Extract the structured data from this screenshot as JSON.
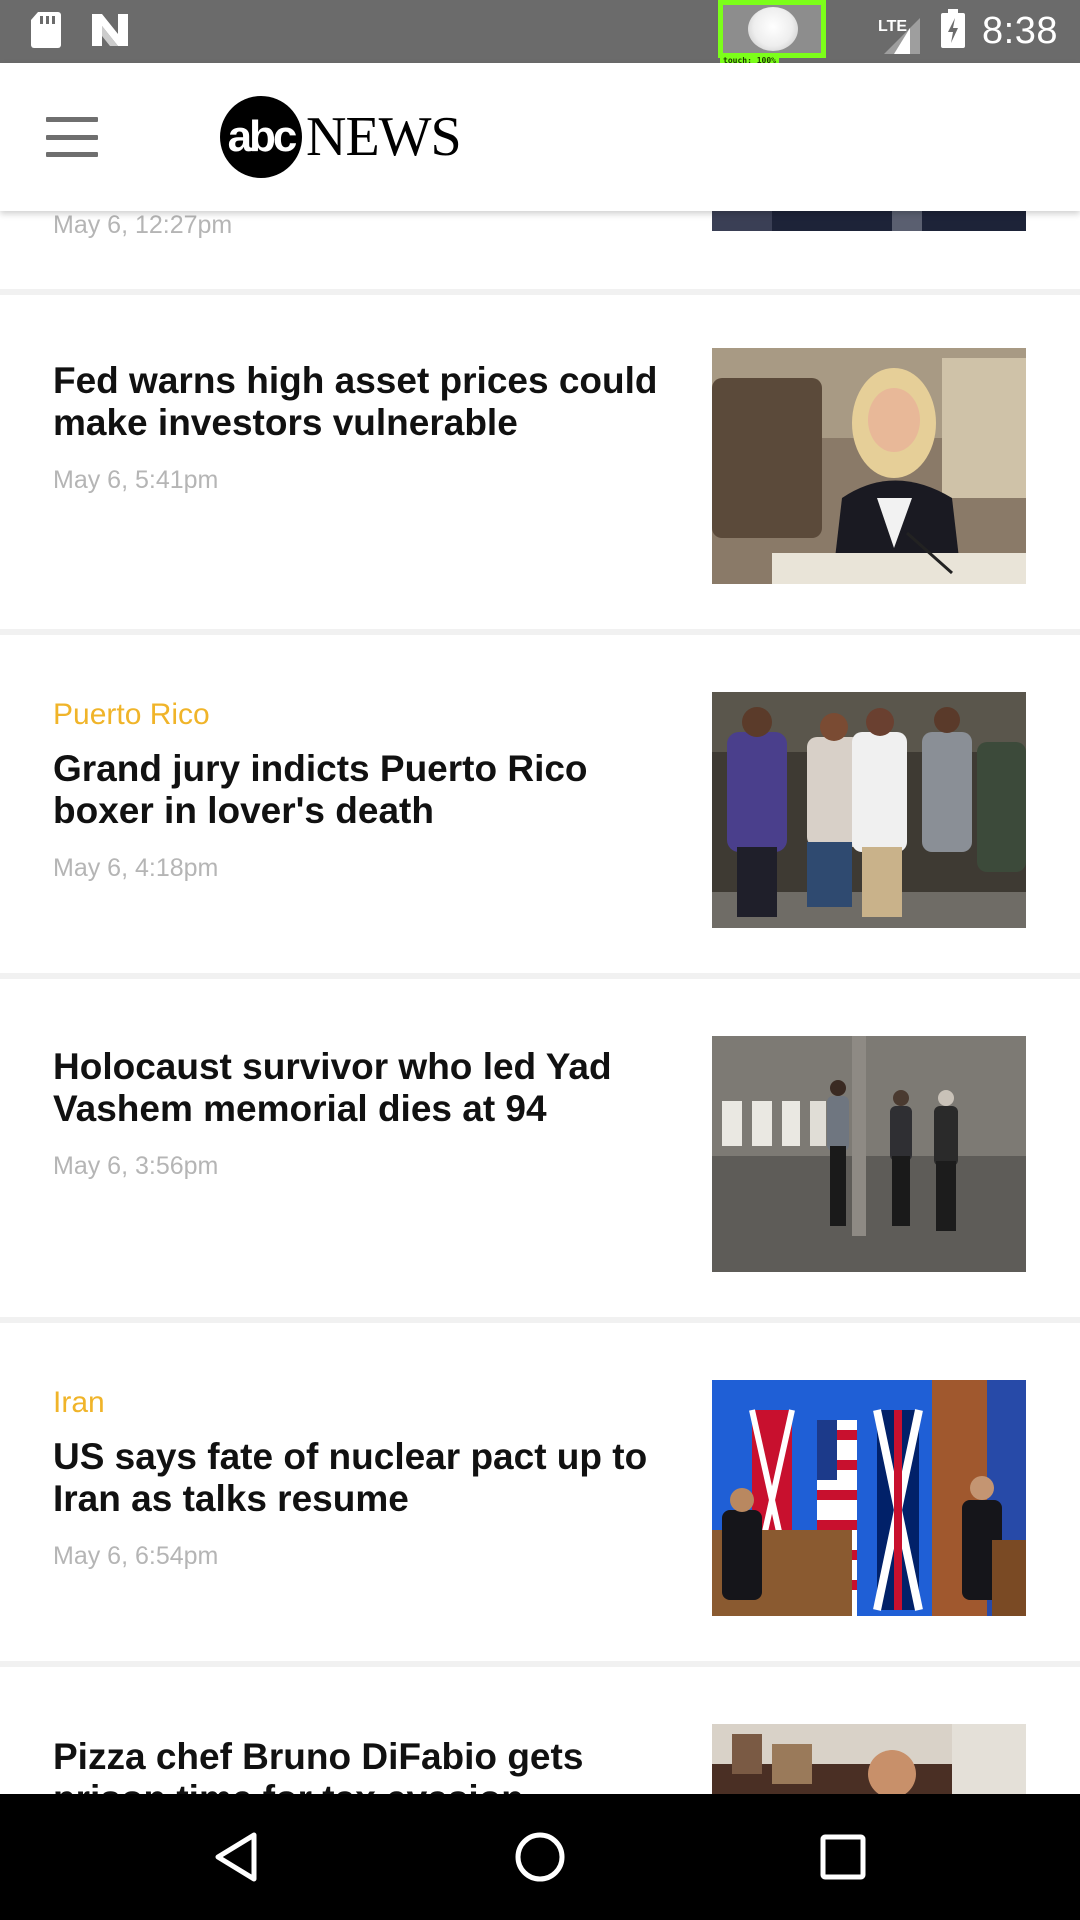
{
  "status_bar": {
    "clock": "8:38",
    "network": "LTE",
    "touch_label": "touch: 100%",
    "left_icons": [
      "sd-card-icon",
      "n-logo-icon"
    ],
    "right_icons": [
      "signal-icon",
      "battery-charging-icon"
    ]
  },
  "app_bar": {
    "logo_circle": "abc",
    "logo_word": "NEWS",
    "menu_icon": "hamburger-menu-icon"
  },
  "articles": [
    {
      "category": "",
      "headline": "",
      "timestamp": "May 6, 12:27pm"
    },
    {
      "category": "",
      "headline": "Fed warns high asset prices could make investors vulnerable",
      "timestamp": "May 6, 5:41pm"
    },
    {
      "category": "Puerto Rico",
      "headline": "Grand jury indicts Puerto Rico boxer in lover's death",
      "timestamp": "May 6, 4:18pm"
    },
    {
      "category": "",
      "headline": "Holocaust survivor who led Yad Vashem memorial dies at 94",
      "timestamp": "May 6, 3:56pm"
    },
    {
      "category": "Iran",
      "headline": "US says fate of nuclear pact up to Iran as talks resume",
      "timestamp": "May 6, 6:54pm"
    },
    {
      "category": "",
      "headline": "Pizza chef Bruno DiFabio gets prison time for tax evasion",
      "timestamp": ""
    }
  ],
  "nav_bar": {
    "icons": [
      "back-triangle-icon",
      "home-circle-icon",
      "recents-square-icon"
    ]
  },
  "colors": {
    "category": "#f0b429",
    "headline": "#111111",
    "timestamp": "#b5b5b5",
    "status_bar": "#6b6b6b",
    "touch_indicator": "#7cff1a"
  }
}
